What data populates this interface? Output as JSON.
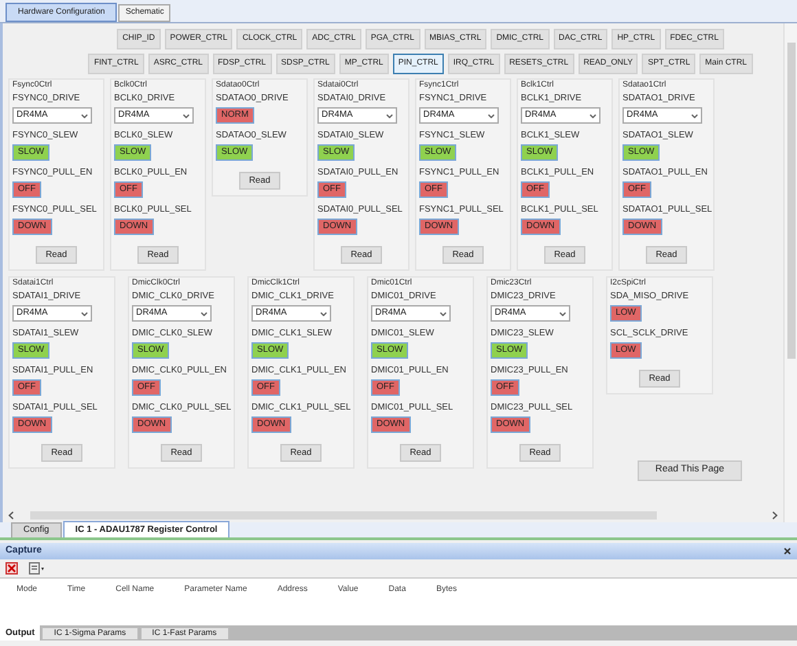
{
  "top_tabs": [
    {
      "label": "Hardware Configuration",
      "selected": true
    },
    {
      "label": "Schematic",
      "selected": false
    }
  ],
  "register_rows": [
    [
      {
        "label": "CHIP_ID",
        "selected": false
      },
      {
        "label": "POWER_CTRL",
        "selected": false
      },
      {
        "label": "CLOCK_CTRL",
        "selected": false
      },
      {
        "label": "ADC_CTRL",
        "selected": false
      },
      {
        "label": "PGA_CTRL",
        "selected": false
      },
      {
        "label": "MBIAS_CTRL",
        "selected": false
      },
      {
        "label": "DMIC_CTRL",
        "selected": false
      },
      {
        "label": "DAC_CTRL",
        "selected": false
      },
      {
        "label": "HP_CTRL",
        "selected": false
      },
      {
        "label": "FDEC_CTRL",
        "selected": false
      }
    ],
    [
      {
        "label": "FINT_CTRL",
        "selected": false
      },
      {
        "label": "ASRC_CTRL",
        "selected": false
      },
      {
        "label": "FDSP_CTRL",
        "selected": false
      },
      {
        "label": "SDSP_CTRL",
        "selected": false
      },
      {
        "label": "MP_CTRL",
        "selected": false
      },
      {
        "label": "PIN_CTRL",
        "selected": true
      },
      {
        "label": "IRQ_CTRL",
        "selected": false
      },
      {
        "label": "RESETS_CTRL",
        "selected": false
      },
      {
        "label": "READ_ONLY",
        "selected": false
      },
      {
        "label": "SPT_CTRL",
        "selected": false
      },
      {
        "label": "Main CTRL",
        "selected": false
      }
    ]
  ],
  "panel_rows": [
    [
      {
        "title": "Fsync0Ctrl",
        "fields": [
          {
            "kind": "dropdown",
            "label": "FSYNC0_DRIVE",
            "value": "DR4MA"
          },
          {
            "kind": "toggle",
            "label": "FSYNC0_SLEW",
            "value": "SLOW",
            "color": "#8fd14f"
          },
          {
            "kind": "toggle",
            "label": "FSYNC0_PULL_EN",
            "value": "OFF",
            "color": "#e06666"
          },
          {
            "kind": "toggle",
            "label": "FSYNC0_PULL_SEL",
            "value": "DOWN",
            "color": "#e06666"
          }
        ],
        "button": "Read"
      },
      {
        "title": "Bclk0Ctrl",
        "fields": [
          {
            "kind": "dropdown",
            "label": "BCLK0_DRIVE",
            "value": "DR4MA"
          },
          {
            "kind": "toggle",
            "label": "BCLK0_SLEW",
            "value": "SLOW",
            "color": "#8fd14f"
          },
          {
            "kind": "toggle",
            "label": "BCLK0_PULL_EN",
            "value": "OFF",
            "color": "#e06666"
          },
          {
            "kind": "toggle",
            "label": "BCLK0_PULL_SEL",
            "value": "DOWN",
            "color": "#e06666"
          }
        ],
        "button": "Read"
      },
      {
        "title": "Sdatao0Ctrl",
        "fields": [
          {
            "kind": "toggle",
            "label": "SDATAO0_DRIVE",
            "value": "NORM",
            "color": "#e06666"
          },
          {
            "kind": "toggle",
            "label": "SDATAO0_SLEW",
            "value": "SLOW",
            "color": "#8fd14f"
          }
        ],
        "button": "Read"
      },
      {
        "title": "Sdatai0Ctrl",
        "fields": [
          {
            "kind": "dropdown",
            "label": "SDATAI0_DRIVE",
            "value": "DR4MA"
          },
          {
            "kind": "toggle",
            "label": "SDATAI0_SLEW",
            "value": "SLOW",
            "color": "#8fd14f"
          },
          {
            "kind": "toggle",
            "label": "SDATAI0_PULL_EN",
            "value": "OFF",
            "color": "#e06666"
          },
          {
            "kind": "toggle",
            "label": "SDATAI0_PULL_SEL",
            "value": "DOWN",
            "color": "#e06666"
          }
        ],
        "button": "Read"
      },
      {
        "title": "Fsync1Ctrl",
        "fields": [
          {
            "kind": "dropdown",
            "label": "FSYNC1_DRIVE",
            "value": "DR4MA"
          },
          {
            "kind": "toggle",
            "label": "FSYNC1_SLEW",
            "value": "SLOW",
            "color": "#8fd14f"
          },
          {
            "kind": "toggle",
            "label": "FSYNC1_PULL_EN",
            "value": "OFF",
            "color": "#e06666"
          },
          {
            "kind": "toggle",
            "label": "FSYNC1_PULL_SEL",
            "value": "DOWN",
            "color": "#e06666"
          }
        ],
        "button": "Read"
      },
      {
        "title": "Bclk1Ctrl",
        "fields": [
          {
            "kind": "dropdown",
            "label": "BCLK1_DRIVE",
            "value": "DR4MA"
          },
          {
            "kind": "toggle",
            "label": "BCLK1_SLEW",
            "value": "SLOW",
            "color": "#8fd14f"
          },
          {
            "kind": "toggle",
            "label": "BCLK1_PULL_EN",
            "value": "OFF",
            "color": "#e06666"
          },
          {
            "kind": "toggle",
            "label": "BCLK1_PULL_SEL",
            "value": "DOWN",
            "color": "#e06666"
          }
        ],
        "button": "Read"
      },
      {
        "title": "Sdatao1Ctrl",
        "fields": [
          {
            "kind": "dropdown",
            "label": "SDATAO1_DRIVE",
            "value": "DR4MA"
          },
          {
            "kind": "toggle",
            "label": "SDATAO1_SLEW",
            "value": "SLOW",
            "color": "#8fd14f"
          },
          {
            "kind": "toggle",
            "label": "SDATAO1_PULL_EN",
            "value": "OFF",
            "color": "#e06666"
          },
          {
            "kind": "toggle",
            "label": "SDATAO1_PULL_SEL",
            "value": "DOWN",
            "color": "#e06666"
          }
        ],
        "button": "Read"
      }
    ],
    [
      {
        "title": "Sdatai1Ctrl",
        "fields": [
          {
            "kind": "dropdown",
            "label": "SDATAI1_DRIVE",
            "value": "DR4MA"
          },
          {
            "kind": "toggle",
            "label": "SDATAI1_SLEW",
            "value": "SLOW",
            "color": "#8fd14f"
          },
          {
            "kind": "toggle",
            "label": "SDATAI1_PULL_EN",
            "value": "OFF",
            "color": "#e06666"
          },
          {
            "kind": "toggle",
            "label": "SDATAI1_PULL_SEL",
            "value": "DOWN",
            "color": "#e06666"
          }
        ],
        "button": "Read"
      },
      {
        "title": "DmicClk0Ctrl",
        "fields": [
          {
            "kind": "dropdown",
            "label": "DMIC_CLK0_DRIVE",
            "value": "DR4MA"
          },
          {
            "kind": "toggle",
            "label": "DMIC_CLK0_SLEW",
            "value": "SLOW",
            "color": "#8fd14f"
          },
          {
            "kind": "toggle",
            "label": "DMIC_CLK0_PULL_EN",
            "value": "OFF",
            "color": "#e06666"
          },
          {
            "kind": "toggle",
            "label": "DMIC_CLK0_PULL_SEL",
            "value": "DOWN",
            "color": "#e06666"
          }
        ],
        "button": "Read"
      },
      {
        "title": "DmicClk1Ctrl",
        "fields": [
          {
            "kind": "dropdown",
            "label": "DMIC_CLK1_DRIVE",
            "value": "DR4MA"
          },
          {
            "kind": "toggle",
            "label": "DMIC_CLK1_SLEW",
            "value": "SLOW",
            "color": "#8fd14f"
          },
          {
            "kind": "toggle",
            "label": "DMIC_CLK1_PULL_EN",
            "value": "OFF",
            "color": "#e06666"
          },
          {
            "kind": "toggle",
            "label": "DMIC_CLK1_PULL_SEL",
            "value": "DOWN",
            "color": "#e06666"
          }
        ],
        "button": "Read"
      },
      {
        "title": "Dmic01Ctrl",
        "fields": [
          {
            "kind": "dropdown",
            "label": "DMIC01_DRIVE",
            "value": "DR4MA"
          },
          {
            "kind": "toggle",
            "label": "DMIC01_SLEW",
            "value": "SLOW",
            "color": "#8fd14f"
          },
          {
            "kind": "toggle",
            "label": "DMIC01_PULL_EN",
            "value": "OFF",
            "color": "#e06666"
          },
          {
            "kind": "toggle",
            "label": "DMIC01_PULL_SEL",
            "value": "DOWN",
            "color": "#e06666"
          }
        ],
        "button": "Read"
      },
      {
        "title": "Dmic23Ctrl",
        "fields": [
          {
            "kind": "dropdown",
            "label": "DMIC23_DRIVE",
            "value": "DR4MA"
          },
          {
            "kind": "toggle",
            "label": "DMIC23_SLEW",
            "value": "SLOW",
            "color": "#8fd14f"
          },
          {
            "kind": "toggle",
            "label": "DMIC23_PULL_EN",
            "value": "OFF",
            "color": "#e06666"
          },
          {
            "kind": "toggle",
            "label": "DMIC23_PULL_SEL",
            "value": "DOWN",
            "color": "#e06666"
          }
        ],
        "button": "Read"
      },
      {
        "title": "I2cSpiCtrl",
        "fields": [
          {
            "kind": "toggle",
            "label": "SDA_MISO_DRIVE",
            "value": "LOW",
            "color": "#e06666"
          },
          {
            "kind": "toggle",
            "label": "SCL_SCLK_DRIVE",
            "value": "LOW",
            "color": "#e06666"
          }
        ],
        "button": "Read"
      }
    ]
  ],
  "read_page_button": "Read This Page",
  "doc_tabs": [
    {
      "label": "Config",
      "selected": false
    },
    {
      "label": "IC 1 - ADAU1787 Register Control",
      "selected": true
    }
  ],
  "capture": {
    "title": "Capture",
    "columns": [
      "Mode",
      "Time",
      "Cell Name",
      "Parameter Name",
      "Address",
      "Value",
      "Data",
      "Bytes"
    ]
  },
  "bottom_tabs": [
    {
      "label": "Output",
      "selected": true
    },
    {
      "label": "IC 1-Sigma Params",
      "selected": false
    },
    {
      "label": "IC 1-Fast Params",
      "selected": false
    }
  ]
}
